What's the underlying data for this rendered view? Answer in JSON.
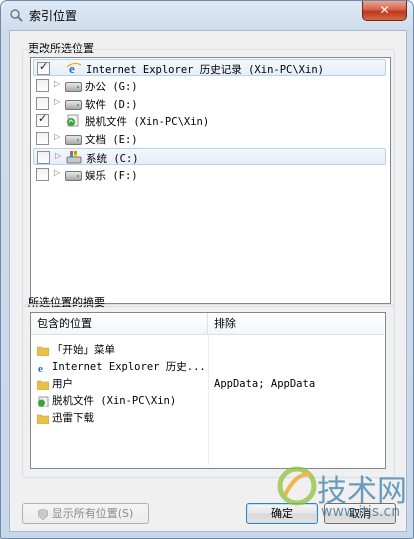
{
  "window": {
    "title": "索引位置",
    "close_label": "✕"
  },
  "change_section": {
    "label": "更改所选位置",
    "items": [
      {
        "label": "Internet Explorer 历史记录 (Xin-PC\\Xin)",
        "checked": true,
        "icon": "ie-icon",
        "expandable": false,
        "selected": true
      },
      {
        "label": "办公 (G:)",
        "checked": false,
        "icon": "drive-icon",
        "expandable": true,
        "selected": false
      },
      {
        "label": "软件 (D:)",
        "checked": false,
        "icon": "drive-icon",
        "expandable": true,
        "selected": false
      },
      {
        "label": "脱机文件 (Xin-PC\\Xin)",
        "checked": true,
        "icon": "offline-files-icon",
        "expandable": false,
        "selected": false
      },
      {
        "label": "文档 (E:)",
        "checked": false,
        "icon": "drive-icon",
        "expandable": true,
        "selected": false
      },
      {
        "label": "系统 (C:)",
        "checked": false,
        "icon": "windows-drive-icon",
        "expandable": true,
        "selected": true
      },
      {
        "label": "娱乐 (F:)",
        "checked": false,
        "icon": "drive-icon",
        "expandable": true,
        "selected": false
      }
    ]
  },
  "summary_section": {
    "label": "所选位置的摘要",
    "columns": [
      "包含的位置",
      "排除"
    ],
    "rows": [
      {
        "location": "「开始」菜单",
        "exclude": "",
        "icon": "folder-icon"
      },
      {
        "location": "Internet Explorer 历史...",
        "exclude": "",
        "icon": "ie-icon"
      },
      {
        "location": "用户",
        "exclude": "AppData; AppData",
        "icon": "folder-icon"
      },
      {
        "location": "脱机文件 (Xin-PC\\Xin)",
        "exclude": "",
        "icon": "offline-files-icon"
      },
      {
        "location": "迅雷下载",
        "exclude": "",
        "icon": "folder-icon"
      }
    ]
  },
  "buttons": {
    "show_all": "显示所有位置(S)",
    "ok": "确定",
    "cancel": "取消"
  },
  "watermark": {
    "logo_text": "技术网",
    "url": "www.itjs.cn"
  },
  "colors": {
    "selection": "#e5eef9",
    "close": "#c0361c",
    "ie_blue": "#1e6fd0"
  }
}
